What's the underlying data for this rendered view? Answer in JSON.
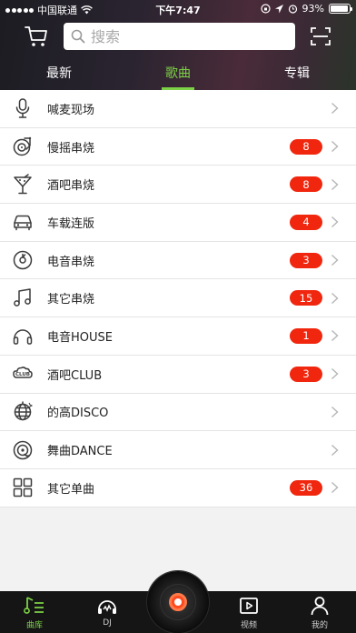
{
  "status_bar": {
    "carrier": "中国联通",
    "time": "下午7:47",
    "battery": "93%",
    "battery_level": 0.93
  },
  "search": {
    "placeholder": "搜索"
  },
  "tabs": [
    {
      "label": "最新",
      "active": false
    },
    {
      "label": "歌曲",
      "active": true
    },
    {
      "label": "专辑",
      "active": false
    }
  ],
  "categories": [
    {
      "label": "喊麦现场",
      "icon": "microphone-icon",
      "count": null
    },
    {
      "label": "慢摇串烧",
      "icon": "turntable-icon",
      "count": "8"
    },
    {
      "label": "酒吧串烧",
      "icon": "cocktail-icon",
      "count": "8"
    },
    {
      "label": "车载连版",
      "icon": "car-icon",
      "count": "4"
    },
    {
      "label": "电音串烧",
      "icon": "vinyl-icon",
      "count": "3"
    },
    {
      "label": "其它串烧",
      "icon": "music-note-icon",
      "count": "15"
    },
    {
      "label": "电音HOUSE",
      "icon": "headphones-icon",
      "count": "1"
    },
    {
      "label": "酒吧CLUB",
      "icon": "club-icon",
      "count": "3"
    },
    {
      "label": "的高DISCO",
      "icon": "disco-ball-icon",
      "count": null
    },
    {
      "label": "舞曲DANCE",
      "icon": "dance-disc-icon",
      "count": null
    },
    {
      "label": "其它单曲",
      "icon": "grid-icon",
      "count": "36"
    }
  ],
  "bottom_nav": [
    {
      "label": "曲库",
      "icon": "library-icon",
      "active": true
    },
    {
      "label": "DJ",
      "icon": "dj-headphones-icon",
      "active": false
    },
    {
      "label": "视频",
      "icon": "video-icon",
      "active": false
    },
    {
      "label": "我的",
      "icon": "profile-icon",
      "active": false
    }
  ],
  "colors": {
    "accent_green": "#7cd146",
    "badge_red": "#f0270e",
    "nav_background": "#151515"
  }
}
